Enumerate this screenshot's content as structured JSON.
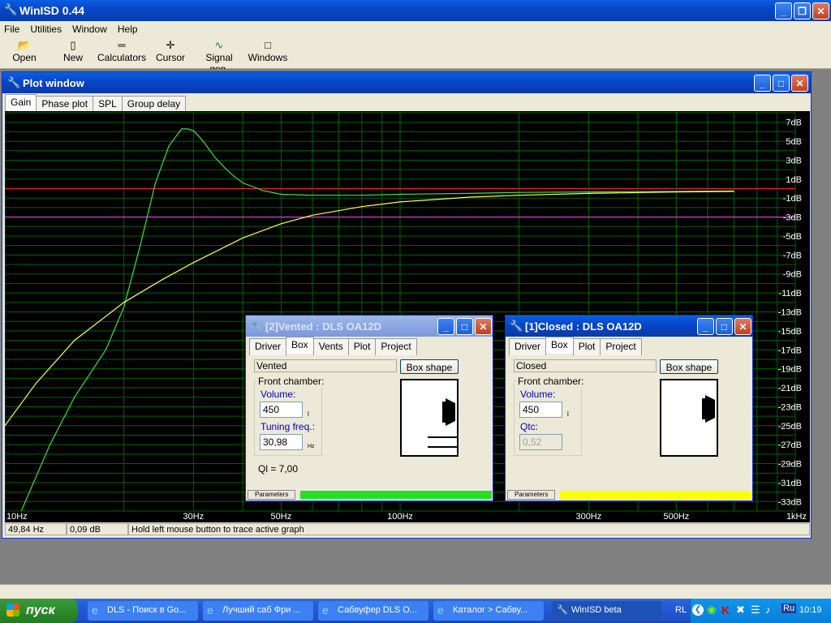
{
  "app": {
    "title": "WinISD 0.44"
  },
  "menu": [
    "File",
    "Utilities",
    "Window",
    "Help"
  ],
  "toolbar": [
    {
      "label": "Open",
      "icon": "folder-open-icon"
    },
    {
      "label": "New",
      "icon": "new-document-icon"
    },
    {
      "label": "Calculators",
      "icon": "calculator-icon"
    },
    {
      "label": "Cursor",
      "icon": "crosshair-icon"
    },
    {
      "label": "Signal gen.",
      "icon": "signal-generator-icon"
    },
    {
      "label": "Windows",
      "icon": "windows-icon"
    }
  ],
  "plot_window": {
    "title": "Plot window",
    "tabs": [
      "Gain",
      "Phase plot",
      "SPL",
      "Group delay"
    ],
    "status": {
      "freq": "49,84 Hz",
      "gain": "0,09 dB",
      "hint": "Hold left mouse button to trace active graph"
    }
  },
  "chart_data": {
    "type": "line",
    "x_scale": "log",
    "xlim": [
      10,
      1000
    ],
    "ylim": [
      -34,
      8
    ],
    "x_ticks": [
      {
        "v": 10,
        "label": "10Hz"
      },
      {
        "v": 30,
        "label": "30Hz"
      },
      {
        "v": 50,
        "label": "50Hz"
      },
      {
        "v": 100,
        "label": "100Hz"
      },
      {
        "v": 300,
        "label": "300Hz"
      },
      {
        "v": 500,
        "label": "500Hz"
      },
      {
        "v": 1000,
        "label": "1kHz"
      }
    ],
    "y_ticks": [
      7,
      5,
      3,
      1,
      -1,
      -3,
      -5,
      -7,
      -9,
      -11,
      -13,
      -15,
      -17,
      -19,
      -21,
      -23,
      -25,
      -27,
      -29,
      -31,
      -33
    ],
    "y_tick_labels": [
      "7dB",
      "5dB",
      "3dB",
      "1dB",
      "-1dB",
      "-3dB",
      "-5dB",
      "-7dB",
      "-9dB",
      "-11dB",
      "-13dB",
      "-15dB",
      "-17dB",
      "-19dB",
      "-21dB",
      "-23dB",
      "-25dB",
      "-27dB",
      "-29dB",
      "-31dB",
      "-33dB"
    ],
    "reference_lines": [
      {
        "y": 0,
        "color": "#ff2020"
      },
      {
        "y": -3,
        "color": "#ff40ff"
      }
    ],
    "series": [
      {
        "color": "#40e040",
        "x": [
          11,
          13,
          15,
          18,
          20,
          22,
          24,
          26,
          28,
          29,
          30,
          31,
          32,
          34,
          36,
          38,
          40,
          45,
          50,
          60,
          80,
          100,
          150,
          200,
          300,
          500,
          700
        ],
        "y": [
          -34,
          -27,
          -22,
          -17,
          -12.5,
          -6,
          0.5,
          4.5,
          6.3,
          6.3,
          6.1,
          5.5,
          4.8,
          3.3,
          2.2,
          1.3,
          0.6,
          -0.2,
          -0.6,
          -0.7,
          -0.7,
          -0.6,
          -0.5,
          -0.4,
          -0.35,
          -0.3,
          -0.25
        ]
      },
      {
        "color": "#ffff40",
        "x": [
          10,
          12,
          15,
          20,
          25,
          30,
          40,
          50,
          60,
          80,
          100,
          150,
          200,
          300,
          500,
          700
        ],
        "y": [
          -25,
          -20.5,
          -16,
          -12,
          -9.6,
          -7.8,
          -5.2,
          -3.7,
          -2.8,
          -1.9,
          -1.4,
          -0.9,
          -0.7,
          -0.5,
          -0.35,
          -0.3
        ]
      }
    ]
  },
  "vented": {
    "title": "[2]Vented : DLS OA12D",
    "tabs": [
      "Driver",
      "Box",
      "Vents",
      "Plot",
      "Project"
    ],
    "box_type": "Vented",
    "box_shape_button": "Box shape",
    "group_label": "Front chamber:",
    "volume_label": "Volume:",
    "volume_value": "450",
    "volume_unit": "l",
    "tuning_label": "Tuning freq.:",
    "tuning_value": "30,98",
    "tuning_unit": "Hz",
    "ql": "Ql = 7,00",
    "params_tab": "Parameters",
    "color": "#22e022"
  },
  "closed": {
    "title": "[1]Closed : DLS OA12D",
    "tabs": [
      "Driver",
      "Box",
      "Plot",
      "Project"
    ],
    "box_type": "Closed",
    "box_shape_button": "Box shape",
    "group_label": "Front chamber:",
    "volume_label": "Volume:",
    "volume_value": "450",
    "volume_unit": "l",
    "qtc_label": "Qtc:",
    "qtc_value": "0,52",
    "params_tab": "Parameters",
    "color": "#ffff00"
  },
  "taskbar": {
    "start": "пуск",
    "tasks": [
      {
        "label": "DLS - Поиск в Go...",
        "active": false
      },
      {
        "label": "Лучший саб Фри ...",
        "active": false
      },
      {
        "label": "Сабвуфер DLS O...",
        "active": false
      },
      {
        "label": "Каталог > Сабву...",
        "active": false
      },
      {
        "label": "WinISD beta",
        "active": true
      }
    ],
    "lang": "RL",
    "kbd": "Ru",
    "clock": "10:19"
  }
}
